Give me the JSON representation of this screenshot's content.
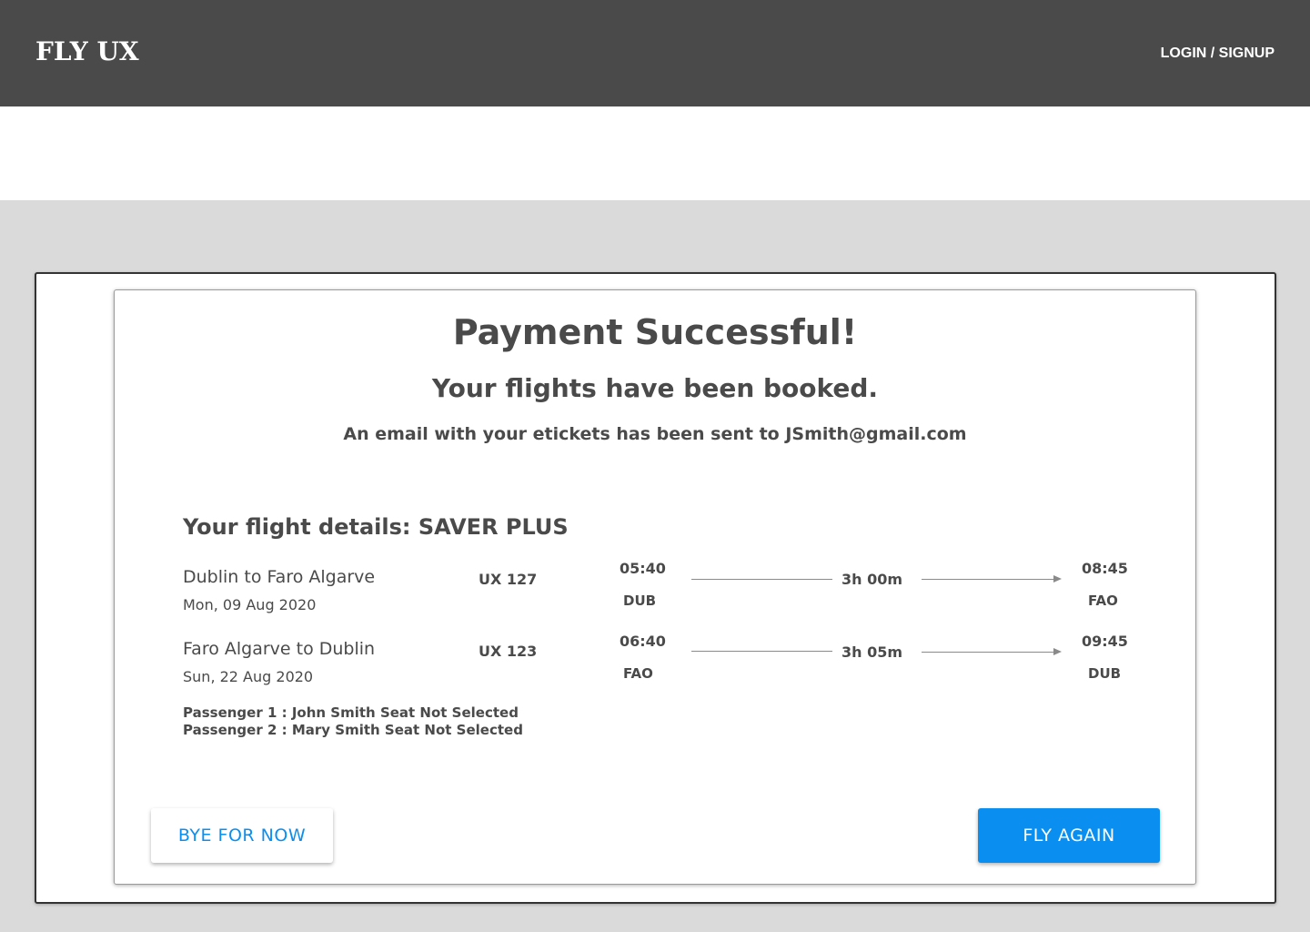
{
  "header": {
    "logo": "FLY UX",
    "login_label": "LOGIN / SIGNUP"
  },
  "confirmation": {
    "title": "Payment Successful!",
    "subtitle": "Your flights have been booked.",
    "email_message": "An email with your etickets has been sent to JSmith@gmail.com"
  },
  "details": {
    "title": "Your flight details: SAVER PLUS",
    "flights": [
      {
        "route": "Dublin to Faro Algarve",
        "date": "Mon, 09 Aug 2020",
        "flight_no": "UX 127",
        "depart_time": "05:40",
        "depart_code": "DUB",
        "duration": "3h 00m",
        "arrive_time": "08:45",
        "arrive_code": "FAO"
      },
      {
        "route": "Faro Algarve to Dublin",
        "date": "Sun, 22 Aug 2020",
        "flight_no": "UX 123",
        "depart_time": "06:40",
        "depart_code": "FAO",
        "duration": "3h 05m",
        "arrive_time": "09:45",
        "arrive_code": "DUB"
      }
    ],
    "passengers": [
      "Passenger 1 : John Smith  Seat Not Selected",
      "Passenger 2 : Mary Smith Seat Not Selected"
    ]
  },
  "actions": {
    "secondary_label": "BYE FOR NOW",
    "primary_label": "FLY AGAIN"
  },
  "colors": {
    "header_bg": "#4a4a4a",
    "page_bg": "#dadada",
    "accent": "#0a8ff0",
    "text": "#4a4a4a"
  }
}
